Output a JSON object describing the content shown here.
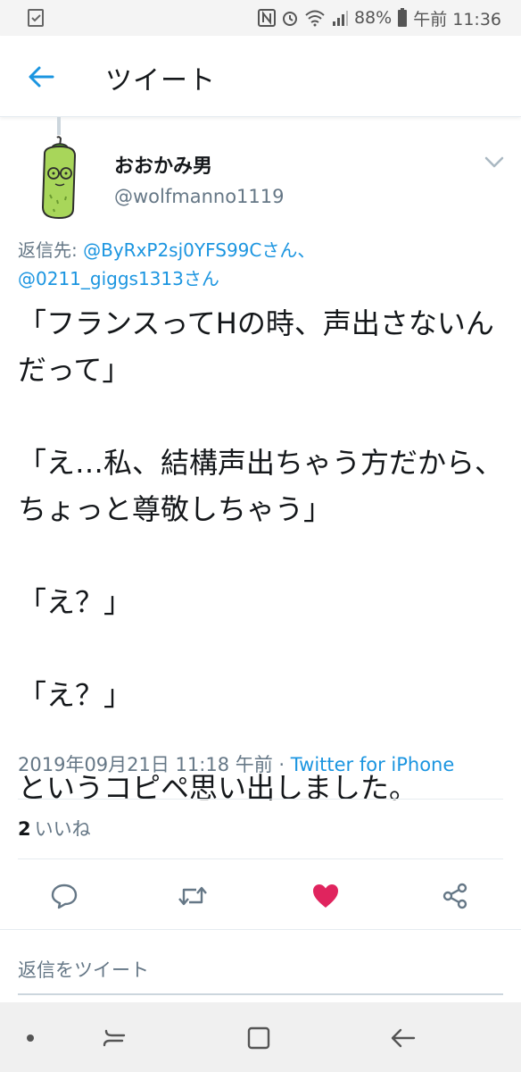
{
  "status_bar": {
    "battery": "88%",
    "time": "午前 11:36"
  },
  "header": {
    "title": "ツイート",
    "back_icon": "arrow-left-icon"
  },
  "tweet": {
    "author_name": "おおかみ男",
    "author_handle": "@wolfmanno1119",
    "reply_prefix": "返信先: ",
    "reply_mention_1": "@ByRxP2sj0YFS99Cさん、",
    "reply_mention_2": "@0211_giggs1313さん",
    "text_lines": [
      "「フランスってHの時、声出さないんだって」",
      "「え…私、結構声出ちゃう方だから、ちょっと尊敬しちゃう」",
      "「え？」",
      "「え？」",
      "というコピペ思い出しました。"
    ],
    "timestamp": "2019年09月21日 11:18 午前 · ",
    "source": "Twitter for iPhone",
    "likes_count": "2",
    "likes_label": "いいね"
  },
  "actions": {
    "reply_icon": "reply-icon",
    "retweet_icon": "retweet-icon",
    "like_icon": "heart-icon",
    "share_icon": "share-icon",
    "like_color": "#e0245e",
    "icon_color": "#657786"
  },
  "reply_input": {
    "placeholder": "返信をツイート"
  },
  "colors": {
    "accent": "#1b95e0",
    "secondary_text": "#657786",
    "primary_text": "#14171a"
  }
}
